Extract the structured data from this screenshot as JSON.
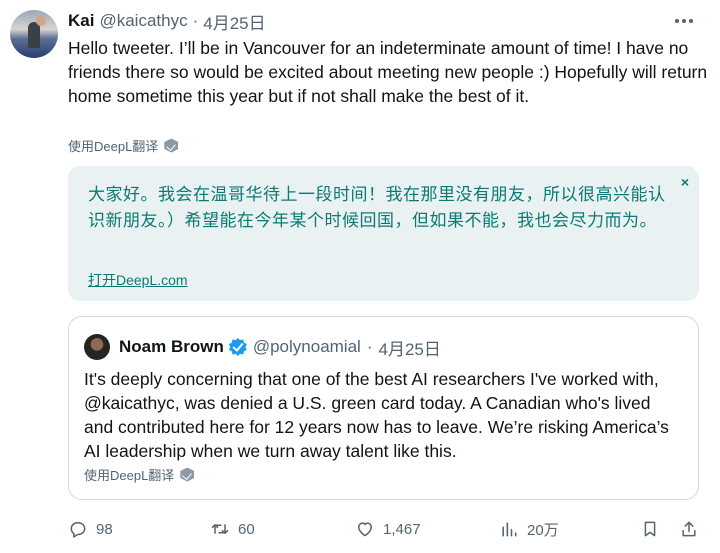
{
  "author": {
    "name": "Kai",
    "handle": "@kaicathyc",
    "separator": "·",
    "date": "4月25日"
  },
  "tweet_text": "Hello tweeter. I’ll be in Vancouver for an indeterminate amount of time! I have no friends there so would be excited about meeting new people :) Hopefully will return home sometime this year but if not shall make the best of it.",
  "translate_label": "使用DeepL翻译",
  "translation": {
    "text": "大家好。我会在温哥华待上一段时间！我在那里没有朋友，所以很高兴能认识新朋友。）希望能在今年某个时候回国，但如果不能，我也会尽力而为。",
    "close": "×",
    "open_link": "打开DeepL.com"
  },
  "quote": {
    "name": "Noam Brown",
    "handle": "@polynoamial",
    "separator": "·",
    "date": "4月25日",
    "text": "It's deeply concerning that one of the best AI researchers I've worked with, @kaicathyc, was denied a U.S. green card today. A Canadian who's lived and contributed here for 12 years now has to leave. We’re risking America’s AI leadership when we turn away talent like this.",
    "translate_label": "使用DeepL翻译"
  },
  "actions": {
    "replies": "98",
    "retweets": "60",
    "likes": "1,467",
    "views": "20万"
  },
  "colors": {
    "text": "#0f1419",
    "secondary": "#536471",
    "translation_bg": "#e9f1f3",
    "translation_text": "#0c7a72",
    "verified": "#1d9bf0"
  }
}
